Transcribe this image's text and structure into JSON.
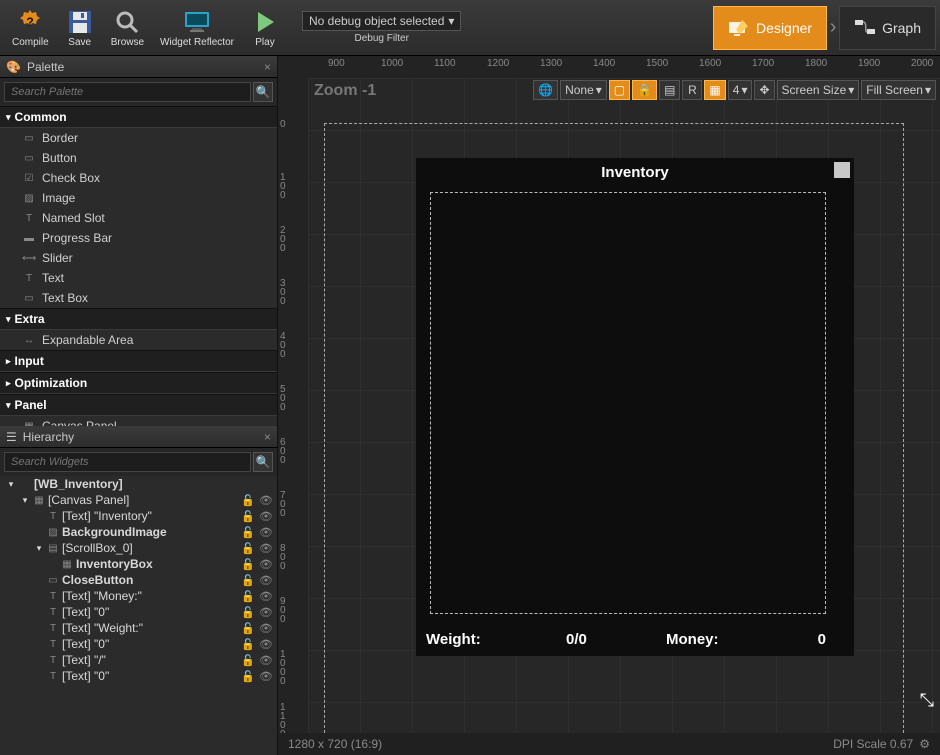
{
  "toolbar": {
    "compile": "Compile",
    "save": "Save",
    "browse": "Browse",
    "reflector": "Widget Reflector",
    "play": "Play",
    "debug_combo": "No debug object selected",
    "debug_label": "Debug Filter"
  },
  "modes": {
    "designer": "Designer",
    "graph": "Graph"
  },
  "palette": {
    "tab": "Palette",
    "search_ph": "Search Palette",
    "categories": [
      {
        "name": "Common",
        "open": true,
        "items": [
          {
            "glyph": "▭",
            "label": "Border"
          },
          {
            "glyph": "▭",
            "label": "Button"
          },
          {
            "glyph": "☑",
            "label": "Check Box"
          },
          {
            "glyph": "▨",
            "label": "Image"
          },
          {
            "glyph": "T",
            "label": "Named Slot"
          },
          {
            "glyph": "▬",
            "label": "Progress Bar"
          },
          {
            "glyph": "⟷",
            "label": "Slider"
          },
          {
            "glyph": "T",
            "label": "Text"
          },
          {
            "glyph": "▭",
            "label": "Text Box"
          }
        ]
      },
      {
        "name": "Extra",
        "open": true,
        "items": [
          {
            "glyph": "↔",
            "label": "Expandable Area"
          }
        ]
      },
      {
        "name": "Input",
        "open": false,
        "items": []
      },
      {
        "name": "Optimization",
        "open": false,
        "items": []
      },
      {
        "name": "Panel",
        "open": true,
        "items": [
          {
            "glyph": "▦",
            "label": "Canvas Panel"
          }
        ]
      }
    ]
  },
  "hierarchy": {
    "tab": "Hierarchy",
    "search_ph": "Search Widgets",
    "rows": [
      {
        "depth": 0,
        "tw": "▾",
        "glyph": "",
        "label": "[WB_Inventory]",
        "bold": true,
        "locks": false
      },
      {
        "depth": 1,
        "tw": "▾",
        "glyph": "▦",
        "label": "[Canvas Panel]",
        "bold": false,
        "locks": true
      },
      {
        "depth": 2,
        "tw": "",
        "glyph": "T",
        "label": "[Text] \"Inventory\"",
        "bold": false,
        "locks": true
      },
      {
        "depth": 2,
        "tw": "",
        "glyph": "▨",
        "label": "BackgroundImage",
        "bold": true,
        "locks": true
      },
      {
        "depth": 2,
        "tw": "▾",
        "glyph": "▤",
        "label": "[ScrollBox_0]",
        "bold": false,
        "locks": true
      },
      {
        "depth": 3,
        "tw": "",
        "glyph": "▦",
        "label": "InventoryBox",
        "bold": true,
        "locks": true
      },
      {
        "depth": 2,
        "tw": "",
        "glyph": "▭",
        "label": "CloseButton",
        "bold": true,
        "locks": true
      },
      {
        "depth": 2,
        "tw": "",
        "glyph": "T",
        "label": "[Text] \"Money:\"",
        "bold": false,
        "locks": true
      },
      {
        "depth": 2,
        "tw": "",
        "glyph": "T",
        "label": "[Text] \"0\"",
        "bold": false,
        "locks": true
      },
      {
        "depth": 2,
        "tw": "",
        "glyph": "T",
        "label": "[Text] \"Weight:\"",
        "bold": false,
        "locks": true
      },
      {
        "depth": 2,
        "tw": "",
        "glyph": "T",
        "label": "[Text] \"0\"",
        "bold": false,
        "locks": true
      },
      {
        "depth": 2,
        "tw": "",
        "glyph": "T",
        "label": "[Text] \"/\"",
        "bold": false,
        "locks": true
      },
      {
        "depth": 2,
        "tw": "",
        "glyph": "T",
        "label": "[Text] \"0\"",
        "bold": false,
        "locks": true
      }
    ]
  },
  "viewport": {
    "zoom": "Zoom -1",
    "ruler_h": [
      "900",
      "1000",
      "1100",
      "1200",
      "1300",
      "1400",
      "1500",
      "1600",
      "1700",
      "1800",
      "1900",
      "2000"
    ],
    "ruler_v": [
      "0",
      "100",
      "200",
      "300",
      "400",
      "500",
      "600",
      "700",
      "800",
      "900",
      "1000",
      "1100"
    ],
    "buttons": {
      "none": "None",
      "r": "R",
      "four": "4",
      "screen": "Screen Size",
      "fill": "Fill Screen"
    },
    "inv": {
      "title": "Inventory",
      "weight_lbl": "Weight:",
      "weight_val": "0/0",
      "money_lbl": "Money:",
      "money_val": "0"
    },
    "status_left": "1280 x 720 (16:9)",
    "status_right": "DPI Scale 0.67"
  }
}
